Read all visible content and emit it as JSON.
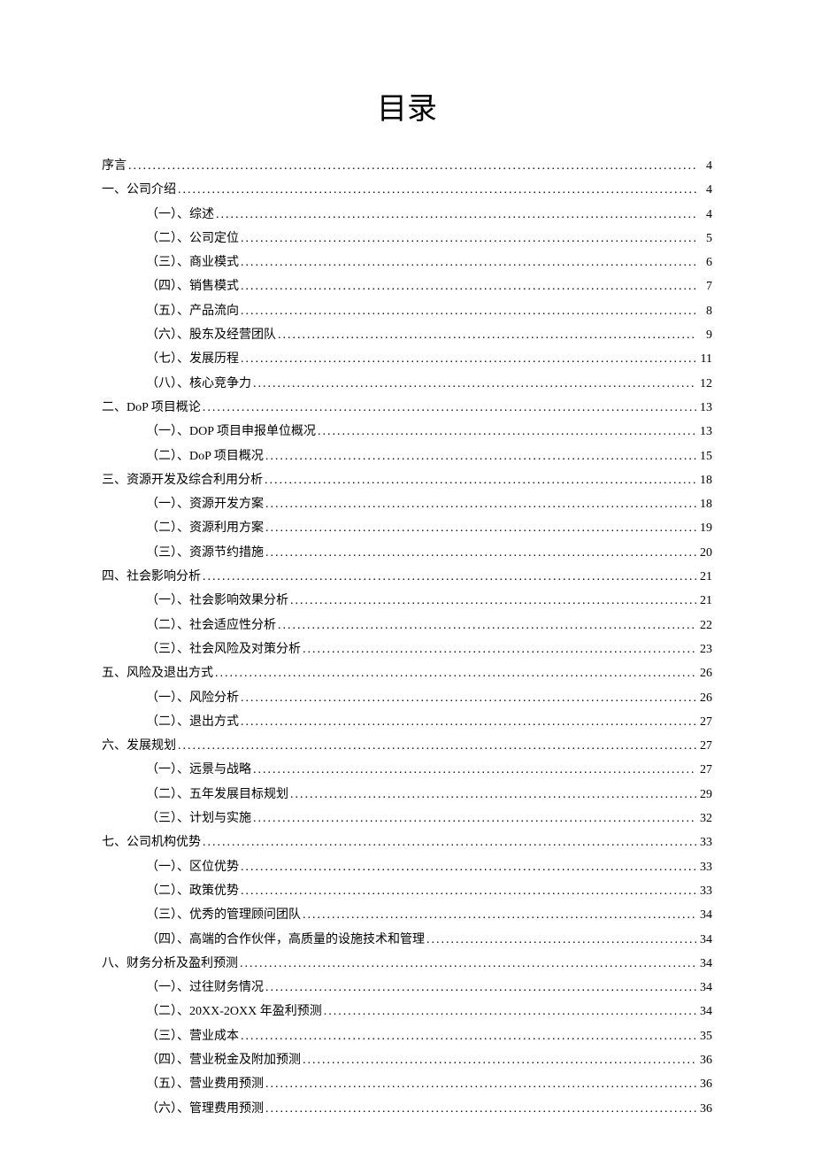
{
  "title": "目录",
  "toc": [
    {
      "level": 1,
      "label": "序言",
      "page": "4"
    },
    {
      "level": 1,
      "label": "一、公司介绍",
      "page": "4"
    },
    {
      "level": 2,
      "label": "（一）、综述",
      "page": "4"
    },
    {
      "level": 2,
      "label": "（二）、公司定位",
      "page": "5"
    },
    {
      "level": 2,
      "label": "（三）、商业模式",
      "page": "6"
    },
    {
      "level": 2,
      "label": "（四）、销售模式",
      "page": "7"
    },
    {
      "level": 2,
      "label": "（五）、产品流向",
      "page": "8"
    },
    {
      "level": 2,
      "label": "（六）、股东及经营团队",
      "page": "9"
    },
    {
      "level": 2,
      "label": "（七）、发展历程",
      "page": "11"
    },
    {
      "level": 2,
      "label": "（八）、核心竞争力",
      "page": "12"
    },
    {
      "level": 1,
      "label": "二、DoP 项目概论",
      "page": "13"
    },
    {
      "level": 2,
      "label": "（一）、DOP 项目申报单位概况",
      "page": "13"
    },
    {
      "level": 2,
      "label": "（二）、DoP 项目概况",
      "page": "15"
    },
    {
      "level": 1,
      "label": "三、资源开发及综合利用分析",
      "page": "18"
    },
    {
      "level": 2,
      "label": "（一）、资源开发方案",
      "page": "18"
    },
    {
      "level": 2,
      "label": "（二）、资源利用方案",
      "page": "19"
    },
    {
      "level": 2,
      "label": "（三）、资源节约措施",
      "page": "20"
    },
    {
      "level": 1,
      "label": "四、社会影响分析",
      "page": "21"
    },
    {
      "level": 2,
      "label": "（一）、社会影响效果分析",
      "page": "21"
    },
    {
      "level": 2,
      "label": "（二）、社会适应性分析",
      "page": "22"
    },
    {
      "level": 2,
      "label": "（三）、社会风险及对策分析",
      "page": "23"
    },
    {
      "level": 1,
      "label": "五、风险及退出方式",
      "page": "26"
    },
    {
      "level": 2,
      "label": "（一）、风险分析",
      "page": "26"
    },
    {
      "level": 2,
      "label": "（二）、退出方式",
      "page": "27"
    },
    {
      "level": 1,
      "label": "六、发展规划",
      "page": "27"
    },
    {
      "level": 2,
      "label": "（一）、远景与战略",
      "page": "27"
    },
    {
      "level": 2,
      "label": "（二）、五年发展目标规划",
      "page": "29"
    },
    {
      "level": 2,
      "label": "（三）、计划与实施",
      "page": "32"
    },
    {
      "level": 1,
      "label": "七、公司机构优势",
      "page": "33"
    },
    {
      "level": 2,
      "label": "（一）、区位优势",
      "page": "33"
    },
    {
      "level": 2,
      "label": "（二）、政策优势",
      "page": "33"
    },
    {
      "level": 2,
      "label": "（三）、优秀的管理顾问团队",
      "page": "34"
    },
    {
      "level": 2,
      "label": "（四）、高端的合作伙伴，高质量的设施技术和管理",
      "page": "34"
    },
    {
      "level": 1,
      "label": "八、财务分析及盈利预测",
      "page": "34"
    },
    {
      "level": 2,
      "label": "（一）、过往财务情况",
      "page": "34"
    },
    {
      "level": 2,
      "label": "（二）、20XX-2OXX 年盈利预测",
      "page": "34"
    },
    {
      "level": 2,
      "label": "（三）、营业成本",
      "page": "35"
    },
    {
      "level": 2,
      "label": "（四）、营业税金及附加预测",
      "page": "36"
    },
    {
      "level": 2,
      "label": "（五）、营业费用预测",
      "page": "36"
    },
    {
      "level": 2,
      "label": "（六）、管理费用预测",
      "page": "36"
    }
  ]
}
